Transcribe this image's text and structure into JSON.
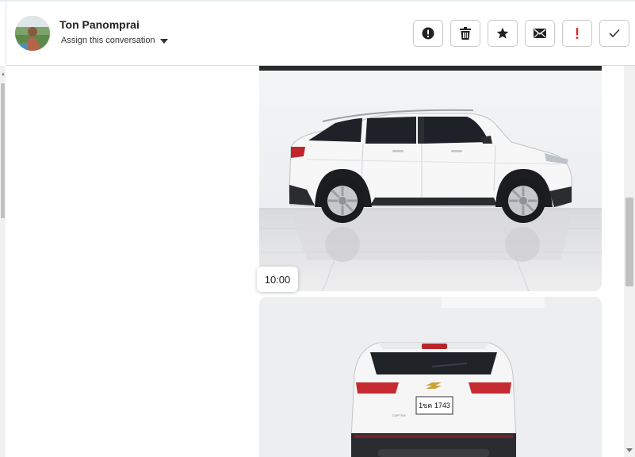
{
  "header": {
    "contact_name": "Ton Panomprai",
    "assign_label": "Assign this conversation",
    "actions": [
      {
        "name": "spam-button",
        "icon": "alert-circle-icon"
      },
      {
        "name": "delete-button",
        "icon": "trash-icon"
      },
      {
        "name": "star-button",
        "icon": "star-icon"
      },
      {
        "name": "mark-unread-button",
        "icon": "envelope-icon"
      },
      {
        "name": "important-button",
        "icon": "exclamation-icon",
        "color": "#e02424"
      },
      {
        "name": "mark-done-button",
        "icon": "check-icon"
      }
    ]
  },
  "messages": [
    {
      "type": "image",
      "subject": "white-suv-side-view",
      "time": "10:00"
    },
    {
      "type": "image",
      "subject": "white-suv-rear-view",
      "plate_text": "1ขค 1743"
    }
  ],
  "colors": {
    "important": "#e02424",
    "border": "#c9c9c9",
    "header_divider": "#dcdcdc"
  }
}
